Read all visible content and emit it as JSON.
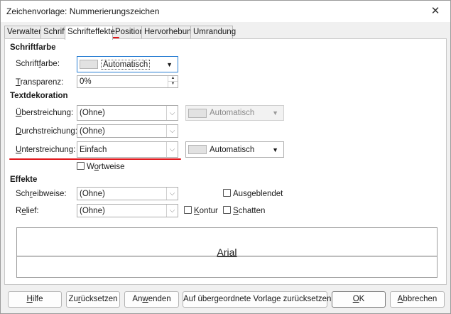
{
  "window": {
    "title": "Zeichenvorlage: Nummerierungszeichen",
    "close_glyph": "✕"
  },
  "tabs": [
    {
      "label": "Verwalten"
    },
    {
      "label": "Schrift"
    },
    {
      "label": "Schrifteffekte"
    },
    {
      "label": "Position"
    },
    {
      "label": "Hervorhebung"
    },
    {
      "label": "Umrandung"
    }
  ],
  "active_tab": "Schrifteffekte",
  "accent_colors": {
    "annotation_red": "#e0161b",
    "focus_blue": "#2a7fd3"
  },
  "schriftfarbe": {
    "heading": "Schriftfarbe",
    "color_label_pre": "Schrift",
    "color_label_mn": "f",
    "color_label_post": "arbe:",
    "color_value": "Automatisch",
    "transparency_label_mn": "T",
    "transparency_label_post": "ransparenz:",
    "transparency_value": "0%"
  },
  "textdekoration": {
    "heading": "Textdekoration",
    "overline": {
      "label_mn": "Ü",
      "label_post": "berstreichung:",
      "value": "(Ohne)",
      "color": "Automatisch"
    },
    "strikethrough": {
      "label_mn": "D",
      "label_post": "urchstreichung:",
      "value": "(Ohne)"
    },
    "underline": {
      "label_mn": "U",
      "label_post": "nterstreichung:",
      "value": "Einfach",
      "color": "Automatisch"
    },
    "wordwise": {
      "label_pre": "W",
      "label_mn": "o",
      "label_post": "rtweise",
      "checked": false
    }
  },
  "effekte": {
    "heading": "Effekte",
    "case": {
      "label_pre": "Sch",
      "label_mn": "r",
      "label_post": "eibweise:",
      "value": "(Ohne)"
    },
    "relief": {
      "label_pre": "R",
      "label_mn": "e",
      "label_post": "lief:",
      "value": "(Ohne)"
    },
    "hidden": {
      "label_pre": "Aus",
      "label_mn": "g",
      "label_post": "eblendet",
      "checked": false
    },
    "outline": {
      "label_mn": "K",
      "label_post": "ontur",
      "checked": false
    },
    "shadow": {
      "label_mn": "S",
      "label_post": "chatten",
      "checked": false
    }
  },
  "preview": {
    "text": "Arial"
  },
  "buttons": {
    "help": {
      "mn": "H",
      "post": "ilfe"
    },
    "reset": {
      "pre": "Zu",
      "mn": "r",
      "post": "ücksetzen"
    },
    "apply": {
      "pre": "An",
      "mn": "w",
      "post": "enden"
    },
    "parent": {
      "label": "Auf übergeordnete Vorlage zurücksetzen"
    },
    "ok": {
      "mn": "O",
      "post": "K"
    },
    "cancel": {
      "mn": "A",
      "post": "bbrechen"
    }
  }
}
